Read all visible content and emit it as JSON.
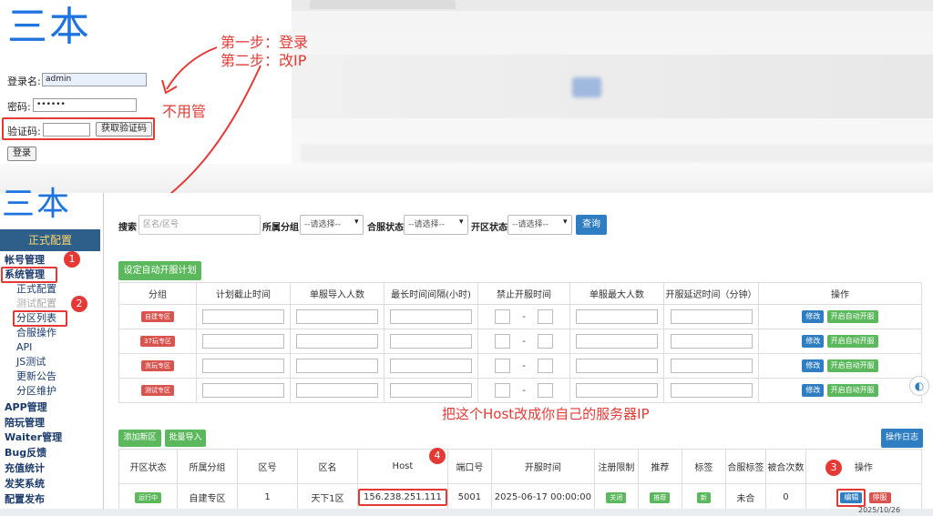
{
  "top_login": {
    "title": "三本",
    "username_label": "登录名:",
    "username_value": "admin",
    "password_label": "密码:",
    "password_value": "••••••",
    "captcha_label": "验证码:",
    "captcha_button": "获取验证码",
    "login_button": "登录"
  },
  "annotations": {
    "step1": "第一步：登录",
    "step2": "第二步：改IP",
    "ignore": "不用管",
    "host_note": "把这个Host改成你自己的服务器IP",
    "marker1": "1",
    "marker2": "2",
    "marker3": "3",
    "marker4": "4"
  },
  "sidebar": {
    "brand": "三本",
    "header": "正式配置",
    "items": [
      {
        "label": "帐号管理",
        "level": 1
      },
      {
        "label": "系统管理",
        "level": 1
      },
      {
        "label": "正式配置",
        "level": 2
      },
      {
        "label": "测试配置",
        "level": 2
      },
      {
        "label": "分区列表",
        "level": 2
      },
      {
        "label": "合服操作",
        "level": 2
      },
      {
        "label": "API",
        "level": 2
      },
      {
        "label": "JS测试",
        "level": 2
      },
      {
        "label": "更新公告",
        "level": 2
      },
      {
        "label": "分区维护",
        "level": 2
      },
      {
        "label": "APP管理",
        "level": 1
      },
      {
        "label": "陪玩管理",
        "level": 1
      },
      {
        "label": "Waiter管理",
        "level": 1
      },
      {
        "label": "Bug反馈",
        "level": 1
      },
      {
        "label": "充值统计",
        "level": 1
      },
      {
        "label": "发奖系统",
        "level": 1
      },
      {
        "label": "配置发布",
        "level": 1
      }
    ]
  },
  "search": {
    "label": "搜索",
    "placeholder": "区名/区号",
    "group_label": "所属分组",
    "group_select": "--请选择--",
    "merge_label": "合服状态",
    "merge_select": "--请选择--",
    "open_label": "开区状态",
    "open_select": "--请选择--",
    "query_button": "查询"
  },
  "auto_plan": {
    "button": "设定自动开服计划",
    "headers": [
      "分组",
      "计划截止时间",
      "单服导入人数",
      "最长时间间隔(小时)",
      "禁止开服时间",
      "单服最大人数",
      "开服延迟时间（分钟）",
      "操作"
    ],
    "rows": [
      {
        "group": "自建专区"
      },
      {
        "group": "37玩专区"
      },
      {
        "group": "贪玩专区"
      },
      {
        "group": "测试专区"
      }
    ],
    "dash": "-",
    "edit_button": "修改",
    "enable_button": "开启自动开服"
  },
  "zone_list": {
    "add_button": "添加新区",
    "import_button": "批量导入",
    "log_button": "操作日志",
    "headers": [
      "开区状态",
      "所属分组",
      "区号",
      "区名",
      "Host",
      "端口号",
      "开服时间",
      "注册限制",
      "推荐",
      "标签",
      "合服标签",
      "被合次数",
      "操作"
    ],
    "row": {
      "status": "运行中",
      "group": "自建专区",
      "zone_id": "1",
      "zone_name": "天下1区",
      "host": "156.238.251.111",
      "port": "5001",
      "open_time": "2025-06-17 00:00:00",
      "register_limit": "关闭",
      "recommend": "推荐",
      "tag": "新",
      "merge_tag": "未合",
      "merge_count": "0",
      "edit_button": "编辑",
      "stop_button": "停服"
    }
  },
  "taskbar": {
    "date": "2025/10/26"
  },
  "colors": {
    "annotation_red": "#e53935",
    "brand_blue": "#1f74e0",
    "button_blue": "#2f7dc3",
    "button_green": "#5cb85c",
    "sidebar_header": "#2e5f8a"
  }
}
